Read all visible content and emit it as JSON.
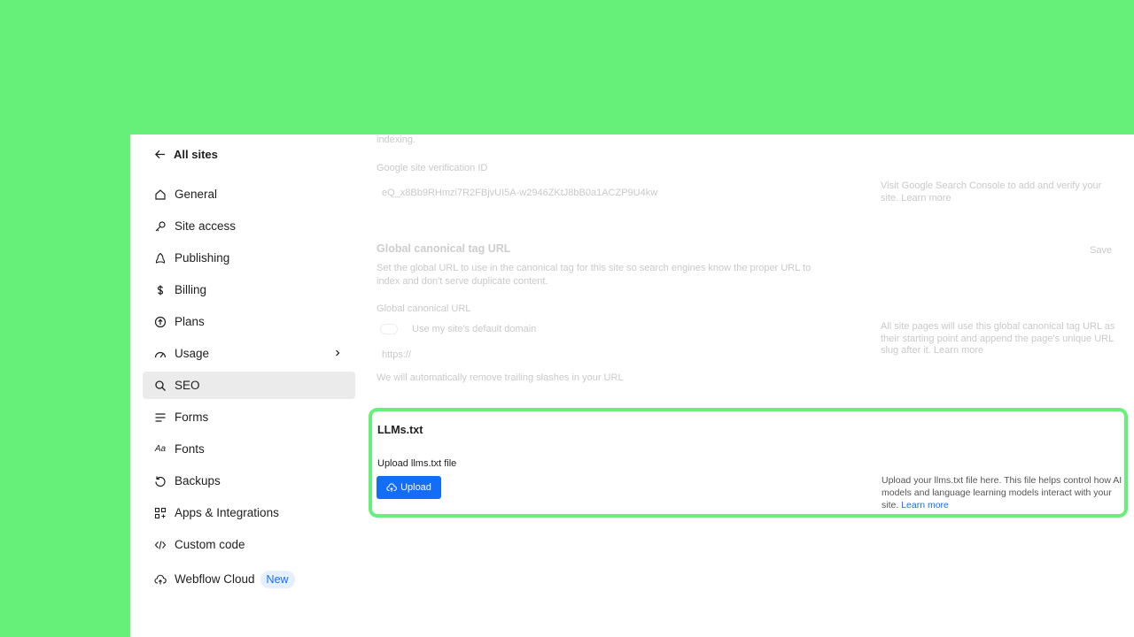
{
  "sidebar": {
    "back_label": "All sites",
    "items": [
      {
        "label": "General",
        "icon": "house-icon"
      },
      {
        "label": "Site access",
        "icon": "key-icon"
      },
      {
        "label": "Publishing",
        "icon": "rocket-icon"
      },
      {
        "label": "Billing",
        "icon": "dollar-icon"
      },
      {
        "label": "Plans",
        "icon": "arrow-circle-icon"
      },
      {
        "label": "Usage",
        "icon": "gauge-icon"
      },
      {
        "label": "SEO",
        "icon": "search-icon",
        "active": true
      },
      {
        "label": "Forms",
        "icon": "lines-icon"
      },
      {
        "label": "Fonts",
        "icon": "font-icon"
      },
      {
        "label": "Backups",
        "icon": "restore-icon"
      },
      {
        "label": "Apps & Integrations",
        "icon": "apps-icon"
      },
      {
        "label": "Custom code",
        "icon": "code-icon"
      },
      {
        "label": "Webflow Cloud",
        "icon": "cloud-icon",
        "badge": "New"
      }
    ]
  },
  "faded": {
    "indexing_tail": "indexing.",
    "verification_label": "Google site verification ID",
    "verification_value": "eQ_x8Bb9RHmzi7R2FBjvUI5A-w2946ZKtJ8bB0a1ACZP9U4kw",
    "verification_help_1": "Visit",
    "verification_help_link": "Google Search Console",
    "verification_help_2": "to add and verify your",
    "verification_help_3": "site.",
    "verification_help_more": "Learn more",
    "canonical_title": "Global canonical tag URL",
    "canonical_save": "Save",
    "canonical_desc_1": "Set the global URL to use in the canonical tag for this site so search engines know the proper URL to",
    "canonical_desc_2": "index and don't serve duplicate content.",
    "canonical_label": "Global canonical URL",
    "canonical_toggle_label": "Use my site's default domain",
    "canonical_placeholder": "https://",
    "canonical_note": "We will automatically remove trailing slashes in your URL",
    "canonical_help_1": "All site pages will use this global canonical tag URL as",
    "canonical_help_2": "their starting point and append the page's unique URL",
    "canonical_help_3": "slug after it.",
    "canonical_help_more": "Learn more"
  },
  "llms": {
    "title": "LLMs.txt",
    "upload_label": "Upload llms.txt file",
    "upload_button": "Upload",
    "help_text": "Upload your llms.txt file here. This file helps control how AI models and language learning models interact with your site.",
    "help_link": "Learn more"
  },
  "colors": {
    "accent": "#146ef5",
    "highlight": "#66ef79",
    "active_item_bg": "#ebebeb"
  }
}
